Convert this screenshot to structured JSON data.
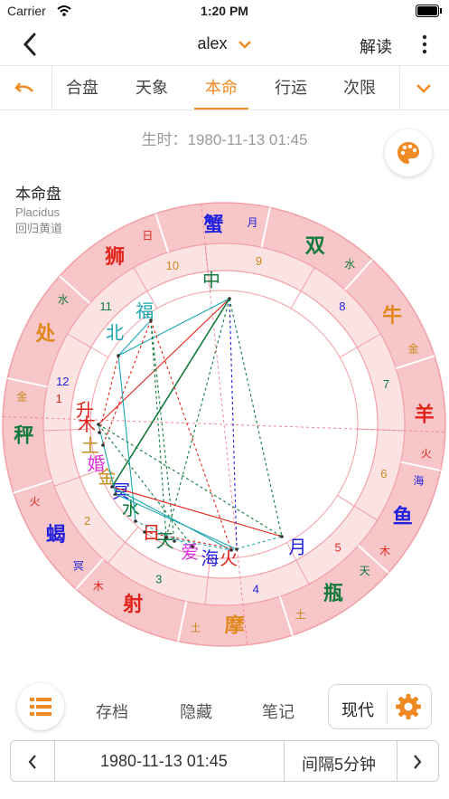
{
  "status": {
    "carrier": "Carrier",
    "time": "1:20 PM"
  },
  "nav": {
    "title": "alex",
    "right_label": "解读"
  },
  "tabs": [
    "合盘",
    "天象",
    "本命",
    "行运",
    "次限"
  ],
  "birth_label": "生时：1980-11-13 01:45",
  "chart_info": {
    "title": "本命盘",
    "system": "Placidus",
    "zodiac": "回归黄道"
  },
  "signs": [
    {
      "name": "双",
      "ruler": "水",
      "color": "#117a3a",
      "ruler_color": "#117a3a"
    },
    {
      "name": "牛",
      "ruler": "金",
      "color": "#e2871a",
      "ruler_color": "#c88a1a"
    },
    {
      "name": "羊",
      "ruler": "火",
      "color": "#e2231a",
      "ruler_color": "#e2231a"
    },
    {
      "name": "鱼",
      "ruler": "木",
      "ruler2": "海",
      "color": "#2222dd",
      "ruler_color": "#e2231a"
    },
    {
      "name": "瓶",
      "ruler": "土",
      "ruler2": "天",
      "color": "#117a3a",
      "ruler_color": "#c88a1a"
    },
    {
      "name": "摩",
      "ruler": "土",
      "color": "#e2871a",
      "ruler_color": "#c88a1a"
    },
    {
      "name": "射",
      "ruler": "木",
      "color": "#e2231a",
      "ruler_color": "#e2231a"
    },
    {
      "name": "蝎",
      "ruler": "火",
      "ruler2": "冥",
      "color": "#2222dd",
      "ruler_color": "#e2231a"
    },
    {
      "name": "秤",
      "ruler": "金",
      "color": "#117a3a",
      "ruler_color": "#c88a1a"
    },
    {
      "name": "处",
      "ruler": "水",
      "color": "#e2871a",
      "ruler_color": "#117a3a"
    },
    {
      "name": "狮",
      "ruler": "日",
      "color": "#e2231a",
      "ruler_color": "#e2231a"
    },
    {
      "name": "蟹",
      "ruler": "月",
      "color": "#2222dd",
      "ruler_color": "#2222dd"
    }
  ],
  "houses": [
    "9",
    "8",
    "7",
    "6",
    "5",
    "4",
    "3",
    "2",
    "1",
    "12",
    "11",
    "10"
  ],
  "points": [
    {
      "label": "中",
      "color": "#117a3a"
    },
    {
      "label": "福",
      "color": "#1aa6b0"
    },
    {
      "label": "北",
      "color": "#1aa6b0"
    },
    {
      "label": "升",
      "color": "#e2231a"
    },
    {
      "label": "木",
      "color": "#e2231a"
    },
    {
      "label": "土",
      "color": "#c88a1a"
    },
    {
      "label": "婚",
      "color": "#dd33dd"
    },
    {
      "label": "金",
      "color": "#c88a1a"
    },
    {
      "label": "冥",
      "color": "#2222dd"
    },
    {
      "label": "水",
      "color": "#117a3a"
    },
    {
      "label": "日",
      "color": "#e2231a"
    },
    {
      "label": "天",
      "color": "#117a3a"
    },
    {
      "label": "爱",
      "color": "#dd33dd"
    },
    {
      "label": "海",
      "color": "#2222dd"
    },
    {
      "label": "火",
      "color": "#e2231a"
    },
    {
      "label": "月",
      "color": "#2222dd"
    }
  ],
  "bottom": {
    "archive": "存档",
    "hide": "隐藏",
    "notes": "笔记",
    "modern": "现代"
  },
  "datebar": {
    "date": "1980-11-13 01:45",
    "interval": "间隔5分钟"
  },
  "colors": {
    "accent": "#f08a24",
    "ring": "#f7c6c9",
    "ring_line": "#f2a0a6"
  },
  "icons": [
    "back-chevron-icon",
    "chevron-down-icon",
    "more-vertical-icon",
    "undo-icon",
    "palette-icon",
    "list-icon",
    "gear-icon",
    "chevron-left-icon",
    "chevron-right-icon"
  ]
}
